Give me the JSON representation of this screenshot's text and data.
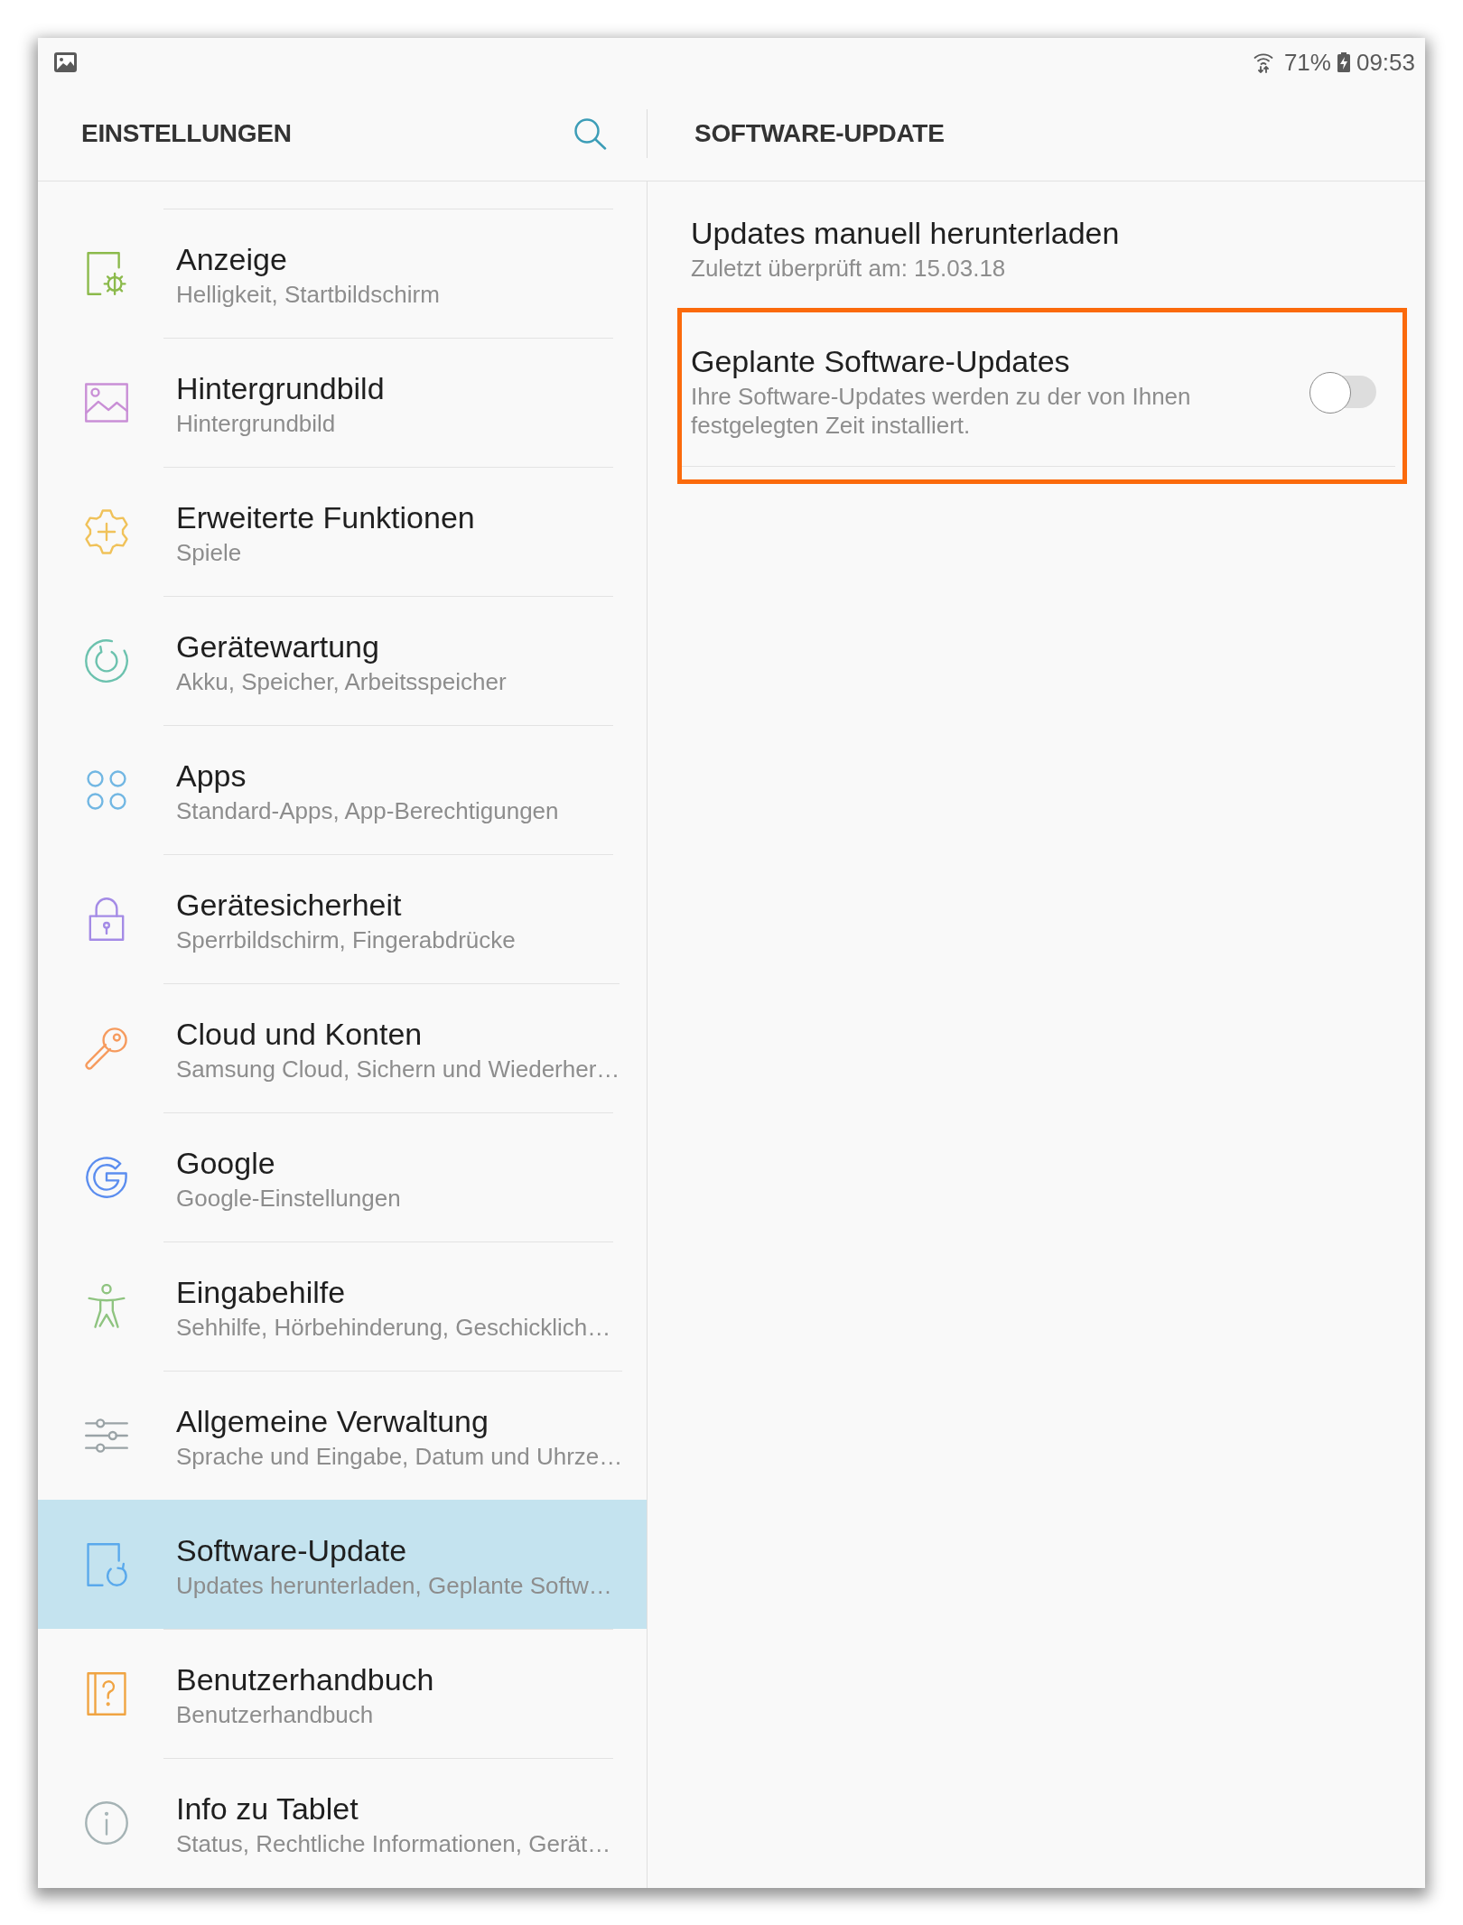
{
  "status_bar": {
    "battery": "71%",
    "time": "09:53"
  },
  "settings_panel": {
    "title": "EINSTELLUNGEN",
    "items": [
      {
        "title": "Anzeige",
        "subtitle": "Helligkeit, Startbildschirm",
        "selected": false
      },
      {
        "title": "Hintergrundbild",
        "subtitle": "Hintergrundbild",
        "selected": false
      },
      {
        "title": "Erweiterte Funktionen",
        "subtitle": "Spiele",
        "selected": false
      },
      {
        "title": "Gerätewartung",
        "subtitle": "Akku, Speicher, Arbeitsspeicher",
        "selected": false
      },
      {
        "title": "Apps",
        "subtitle": "Standard-Apps, App-Berechtigungen",
        "selected": false
      },
      {
        "title": "Gerätesicherheit",
        "subtitle": "Sperrbildschirm, Fingerabdrücke",
        "selected": false
      },
      {
        "title": "Cloud und Konten",
        "subtitle": "Samsung Cloud, Sichern und Wiederher…",
        "selected": false
      },
      {
        "title": "Google",
        "subtitle": "Google-Einstellungen",
        "selected": false
      },
      {
        "title": "Eingabehilfe",
        "subtitle": "Sehhilfe, Hörbehinderung, Geschicklich…",
        "selected": false
      },
      {
        "title": "Allgemeine Verwaltung",
        "subtitle": "Sprache und Eingabe, Datum und Uhrze…",
        "selected": false
      },
      {
        "title": "Software-Update",
        "subtitle": "Updates herunterladen, Geplante Softw…",
        "selected": true
      },
      {
        "title": "Benutzerhandbuch",
        "subtitle": "Benutzerhandbuch",
        "selected": false
      },
      {
        "title": "Info zu Tablet",
        "subtitle": "Status, Rechtliche Informationen, Gerät…",
        "selected": false
      }
    ]
  },
  "detail_panel": {
    "title": "SOFTWARE-UPDATE",
    "items": [
      {
        "kind": "link",
        "title": "Updates manuell herunterladen",
        "subtitle": "Zuletzt überprüft am: 15.03.18",
        "highlighted": false
      },
      {
        "kind": "toggle",
        "title": "Geplante Software-Updates",
        "subtitle": "Ihre Software-Updates werden zu der von Ihnen festgelegten Zeit installiert.",
        "on": false,
        "highlighted": true
      }
    ]
  }
}
